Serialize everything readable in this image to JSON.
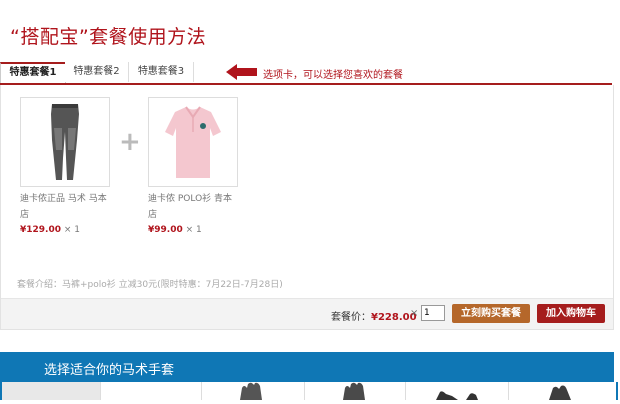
{
  "page": {
    "title": "“搭配宝”套餐使用方法"
  },
  "tabs": [
    {
      "label": "特惠套餐1",
      "active": true
    },
    {
      "label": "特惠套餐2",
      "active": false
    },
    {
      "label": "特惠套餐3",
      "active": false
    }
  ],
  "annotation": {
    "text": "选项卡，可以选择您喜欢的套餐",
    "icon": "left-arrow-icon",
    "color": "#b0141c"
  },
  "products": [
    {
      "name": "迪卡侬正品 马术 马本店",
      "price": "¥129.00",
      "qty": "× 1",
      "icon": "riding-pants-image"
    },
    {
      "name": "迪卡侬 POLO衫 青本店",
      "price": "¥99.00",
      "qty": "× 1",
      "icon": "polo-shirt-image"
    }
  ],
  "plus_symbol": "+",
  "bundle_intro": "套餐介绍：马裤+polo衫 立减30元(限时特惠：7月22日-7月28日)",
  "summary": {
    "total_label": "套餐价：",
    "total_price": "¥228.00",
    "times": "×",
    "quantity": "1",
    "buy_now_label": "立刻购买套餐",
    "add_cart_label": "加入购物车"
  },
  "section": {
    "title": "选择适合你的马术手套",
    "color": "#0f77b5"
  },
  "colors": {
    "accent": "#a51d1d",
    "brand_red": "#b0141c",
    "buy_button": "#b5672a"
  }
}
